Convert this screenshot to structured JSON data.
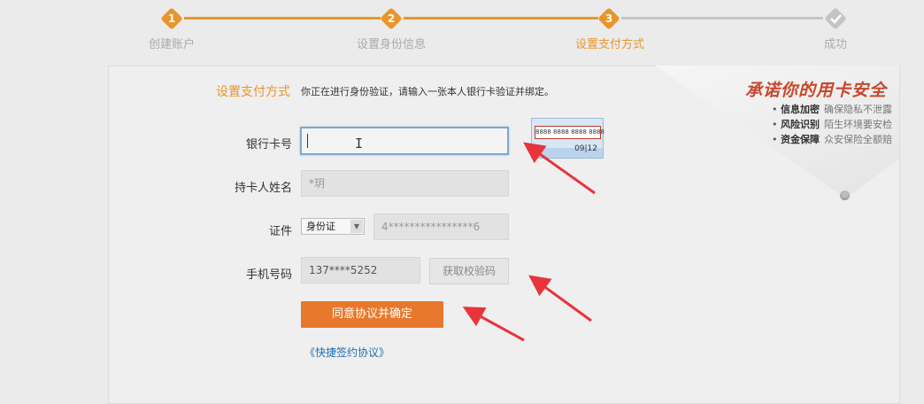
{
  "steps": [
    {
      "number": "1",
      "label": "创建账户",
      "status": "done"
    },
    {
      "number": "2",
      "label": "设置身份信息",
      "status": "done"
    },
    {
      "number": "3",
      "label": "设置支付方式",
      "status": "current"
    },
    {
      "number": "",
      "label": "成功",
      "status": "todo",
      "icon": "check-icon"
    }
  ],
  "section": {
    "title": "设置支付方式",
    "description": "你正在进行身份验证，请输入一张本人银行卡验证并绑定。"
  },
  "form": {
    "card_number": {
      "label": "银行卡号",
      "value": ""
    },
    "holder_name": {
      "label": "持卡人姓名",
      "value": "*玥"
    },
    "id_doc": {
      "label": "证件",
      "type": "身份证",
      "value": "4****************6"
    },
    "phone": {
      "label": "手机号码",
      "value": "137****5252",
      "get_code": "获取校验码"
    },
    "submit": "同意协议并确定",
    "agreement_link": "《快捷签约协议》"
  },
  "card_hint": {
    "number": "8888 8888 8888 8888",
    "expiry": "09|12"
  },
  "promo": {
    "title": "承诺你的用卡安全",
    "items": [
      {
        "bold": "信息加密",
        "text": "确保隐私不泄露"
      },
      {
        "bold": "风险识别",
        "text": "陌生环境要安检"
      },
      {
        "bold": "资金保障",
        "text": "众安保险全额赔"
      }
    ]
  },
  "colors": {
    "accent": "#e8962b",
    "button": "#e8782b",
    "link": "#1f6eb3",
    "annotation_arrow": "#e8343a",
    "promo_title": "#c8472c"
  }
}
